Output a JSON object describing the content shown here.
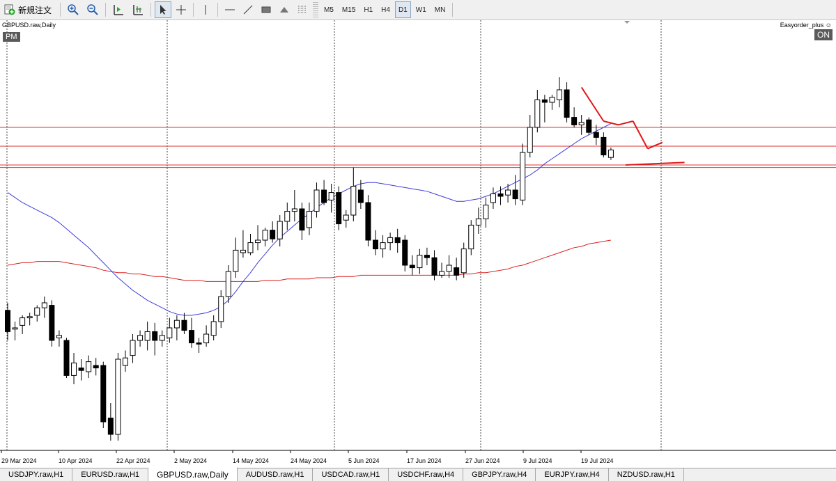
{
  "toolbar": {
    "new_order_label": "新規注文",
    "timeframes": [
      "M5",
      "M15",
      "H1",
      "H4",
      "D1",
      "W1",
      "MN"
    ],
    "active_timeframe": "D1"
  },
  "chart": {
    "title": "GBPUSD.raw,Daily",
    "session_badge": "PM",
    "ea_name": "Easyorder_plus ☺",
    "ea_status": "ON",
    "date_labels": [
      "29 Mar 2024",
      "10 Apr 2024",
      "22 Apr 2024",
      "2 May 2024",
      "14 May 2024",
      "24 May 2024",
      "5 Jun 2024",
      "17 Jun 2024",
      "27 Jun 2024",
      "9 Jul 2024",
      "19 Jul 2024"
    ]
  },
  "colors": {
    "ma_fast": "#3c3cdc",
    "ma_slow": "#dc2020",
    "hline": "#e03030",
    "annotation": "#e01818",
    "candle_bear": "#000000",
    "candle_bull": "#ffffff"
  },
  "chart_data": {
    "type": "candlestick",
    "symbol": "GBPUSD.raw",
    "period": "Daily",
    "candles": [
      {
        "o": 64,
        "h": 70,
        "l": 40,
        "c": 47
      },
      {
        "o": 49,
        "h": 55,
        "l": 40,
        "c": 50
      },
      {
        "o": 52,
        "h": 60,
        "l": 45,
        "c": 58
      },
      {
        "o": 58,
        "h": 62,
        "l": 52,
        "c": 59
      },
      {
        "o": 60,
        "h": 68,
        "l": 55,
        "c": 66
      },
      {
        "o": 66,
        "h": 75,
        "l": 58,
        "c": 70
      },
      {
        "o": 68,
        "h": 72,
        "l": 35,
        "c": 40
      },
      {
        "o": 42,
        "h": 48,
        "l": 35,
        "c": 44
      },
      {
        "o": 40,
        "h": 42,
        "l": 10,
        "c": 12
      },
      {
        "o": 12,
        "h": 30,
        "l": 5,
        "c": 22
      },
      {
        "o": 18,
        "h": 25,
        "l": 8,
        "c": 16
      },
      {
        "o": 15,
        "h": 28,
        "l": 10,
        "c": 23
      },
      {
        "o": 20,
        "h": 26,
        "l": 12,
        "c": 18
      },
      {
        "o": 20,
        "h": 23,
        "l": -30,
        "c": -25
      },
      {
        "o": -22,
        "h": -10,
        "l": -40,
        "c": -35
      },
      {
        "o": -35,
        "h": 30,
        "l": -40,
        "c": 25
      },
      {
        "o": 20,
        "h": 32,
        "l": 15,
        "c": 26
      },
      {
        "o": 28,
        "h": 45,
        "l": 22,
        "c": 40
      },
      {
        "o": 40,
        "h": 48,
        "l": 35,
        "c": 44
      },
      {
        "o": 40,
        "h": 55,
        "l": 32,
        "c": 47
      },
      {
        "o": 47,
        "h": 54,
        "l": 28,
        "c": 40
      },
      {
        "o": 40,
        "h": 48,
        "l": 35,
        "c": 44
      },
      {
        "o": 42,
        "h": 58,
        "l": 38,
        "c": 50
      },
      {
        "o": 50,
        "h": 60,
        "l": 40,
        "c": 56
      },
      {
        "o": 56,
        "h": 62,
        "l": 45,
        "c": 48
      },
      {
        "o": 48,
        "h": 58,
        "l": 34,
        "c": 38
      },
      {
        "o": 38,
        "h": 42,
        "l": 30,
        "c": 37
      },
      {
        "o": 38,
        "h": 52,
        "l": 35,
        "c": 45
      },
      {
        "o": 44,
        "h": 60,
        "l": 40,
        "c": 55
      },
      {
        "o": 55,
        "h": 80,
        "l": 50,
        "c": 75
      },
      {
        "o": 75,
        "h": 100,
        "l": 70,
        "c": 95
      },
      {
        "o": 95,
        "h": 122,
        "l": 90,
        "c": 112
      },
      {
        "o": 110,
        "h": 128,
        "l": 106,
        "c": 112
      },
      {
        "o": 110,
        "h": 125,
        "l": 108,
        "c": 118
      },
      {
        "o": 118,
        "h": 132,
        "l": 112,
        "c": 120
      },
      {
        "o": 120,
        "h": 130,
        "l": 115,
        "c": 128
      },
      {
        "o": 128,
        "h": 135,
        "l": 118,
        "c": 121
      },
      {
        "o": 121,
        "h": 140,
        "l": 115,
        "c": 135
      },
      {
        "o": 135,
        "h": 150,
        "l": 128,
        "c": 143
      },
      {
        "o": 143,
        "h": 160,
        "l": 135,
        "c": 145
      },
      {
        "o": 145,
        "h": 150,
        "l": 120,
        "c": 128
      },
      {
        "o": 130,
        "h": 150,
        "l": 124,
        "c": 143
      },
      {
        "o": 143,
        "h": 166,
        "l": 138,
        "c": 160
      },
      {
        "o": 160,
        "h": 168,
        "l": 148,
        "c": 150
      },
      {
        "o": 152,
        "h": 165,
        "l": 142,
        "c": 158
      },
      {
        "o": 158,
        "h": 163,
        "l": 128,
        "c": 133
      },
      {
        "o": 136,
        "h": 144,
        "l": 130,
        "c": 140
      },
      {
        "o": 140,
        "h": 178,
        "l": 135,
        "c": 163
      },
      {
        "o": 160,
        "h": 168,
        "l": 145,
        "c": 150
      },
      {
        "o": 150,
        "h": 156,
        "l": 115,
        "c": 120
      },
      {
        "o": 120,
        "h": 128,
        "l": 108,
        "c": 113
      },
      {
        "o": 113,
        "h": 124,
        "l": 106,
        "c": 118
      },
      {
        "o": 118,
        "h": 126,
        "l": 112,
        "c": 122
      },
      {
        "o": 122,
        "h": 129,
        "l": 110,
        "c": 118
      },
      {
        "o": 120,
        "h": 124,
        "l": 95,
        "c": 100
      },
      {
        "o": 100,
        "h": 108,
        "l": 92,
        "c": 98
      },
      {
        "o": 98,
        "h": 113,
        "l": 93,
        "c": 108
      },
      {
        "o": 108,
        "h": 114,
        "l": 100,
        "c": 106
      },
      {
        "o": 106,
        "h": 112,
        "l": 88,
        "c": 92
      },
      {
        "o": 92,
        "h": 102,
        "l": 90,
        "c": 95
      },
      {
        "o": 95,
        "h": 108,
        "l": 90,
        "c": 100
      },
      {
        "o": 98,
        "h": 106,
        "l": 88,
        "c": 92
      },
      {
        "o": 94,
        "h": 118,
        "l": 90,
        "c": 113
      },
      {
        "o": 113,
        "h": 136,
        "l": 108,
        "c": 132
      },
      {
        "o": 132,
        "h": 146,
        "l": 125,
        "c": 137
      },
      {
        "o": 137,
        "h": 154,
        "l": 130,
        "c": 148
      },
      {
        "o": 150,
        "h": 162,
        "l": 145,
        "c": 157
      },
      {
        "o": 157,
        "h": 163,
        "l": 148,
        "c": 155
      },
      {
        "o": 156,
        "h": 165,
        "l": 150,
        "c": 160
      },
      {
        "o": 160,
        "h": 172,
        "l": 148,
        "c": 153
      },
      {
        "o": 152,
        "h": 197,
        "l": 148,
        "c": 190
      },
      {
        "o": 190,
        "h": 220,
        "l": 186,
        "c": 210
      },
      {
        "o": 210,
        "h": 240,
        "l": 206,
        "c": 232
      },
      {
        "o": 232,
        "h": 236,
        "l": 214,
        "c": 230
      },
      {
        "o": 230,
        "h": 236,
        "l": 224,
        "c": 234
      },
      {
        "o": 232,
        "h": 250,
        "l": 226,
        "c": 240
      },
      {
        "o": 240,
        "h": 246,
        "l": 214,
        "c": 218
      },
      {
        "o": 218,
        "h": 226,
        "l": 210,
        "c": 212
      },
      {
        "o": 212,
        "h": 220,
        "l": 204,
        "c": 214
      },
      {
        "o": 216,
        "h": 218,
        "l": 204,
        "c": 206
      },
      {
        "o": 206,
        "h": 212,
        "l": 196,
        "c": 202
      },
      {
        "o": 202,
        "h": 206,
        "l": 186,
        "c": 188
      },
      {
        "o": 186,
        "h": 194,
        "l": 184,
        "c": 192
      }
    ],
    "ma_fast": [
      158,
      154,
      150,
      147,
      144,
      141,
      138,
      134,
      129,
      124,
      119,
      114,
      108,
      102,
      96,
      90,
      85,
      80,
      76,
      72,
      69,
      66,
      63,
      61,
      60,
      60,
      61,
      62,
      64,
      67,
      72,
      79,
      87,
      94,
      102,
      109,
      116,
      122,
      127,
      132,
      137,
      141,
      146,
      150,
      154,
      157,
      160,
      163,
      165,
      166,
      166,
      165,
      164,
      163,
      162,
      161,
      160,
      159,
      157,
      155,
      153,
      151,
      151,
      152,
      153,
      155,
      157,
      160,
      163,
      166,
      169,
      172,
      176,
      181,
      185,
      189,
      193,
      197,
      201,
      204,
      207,
      210,
      213
    ],
    "ma_slow": [
      100,
      101,
      102,
      102,
      103,
      103,
      103,
      103,
      102,
      101,
      100,
      99,
      98,
      96,
      95,
      94,
      94,
      93,
      93,
      92,
      91,
      91,
      90,
      89,
      88,
      88,
      88,
      87,
      87,
      87,
      87,
      87,
      87,
      87,
      87,
      88,
      88,
      88,
      89,
      89,
      89,
      89,
      90,
      90,
      90,
      91,
      91,
      91,
      92,
      92,
      92,
      92,
      92,
      92,
      92,
      92,
      92,
      92,
      92,
      92,
      92,
      92,
      93,
      93,
      94,
      94,
      95,
      96,
      97,
      99,
      100,
      102,
      104,
      106,
      108,
      110,
      112,
      114,
      115,
      117,
      118,
      119,
      120
    ],
    "horizontal_lines": [
      210,
      195,
      180,
      178
    ],
    "annotation_lines": [
      {
        "from": [
          78,
          242
        ],
        "to": [
          81,
          215
        ]
      },
      {
        "from": [
          81,
          215
        ],
        "to": [
          83,
          212
        ]
      },
      {
        "from": [
          83,
          212
        ],
        "to": [
          85,
          215
        ]
      },
      {
        "from": [
          85,
          215
        ],
        "to": [
          87,
          193
        ]
      },
      {
        "from": [
          87,
          193
        ],
        "to": [
          89,
          198
        ]
      },
      {
        "from": [
          84,
          180
        ],
        "to": [
          92,
          182
        ]
      }
    ],
    "xlabels": [
      "29 Mar 2024",
      "10 Apr 2024",
      "22 Apr 2024",
      "2 May 2024",
      "14 May 2024",
      "24 May 2024",
      "5 Jun 2024",
      "17 Jun 2024",
      "27 Jun 2024",
      "9 Jul 2024",
      "19 Jul 2024"
    ]
  },
  "tabs": [
    {
      "label": "USDJPY.raw,H1",
      "active": false
    },
    {
      "label": "EURUSD.raw,H1",
      "active": false
    },
    {
      "label": "GBPUSD.raw,Daily",
      "active": true
    },
    {
      "label": "AUDUSD.raw,H1",
      "active": false
    },
    {
      "label": "USDCAD.raw,H1",
      "active": false
    },
    {
      "label": "USDCHF.raw,H4",
      "active": false
    },
    {
      "label": "GBPJPY.raw,H4",
      "active": false
    },
    {
      "label": "EURJPY.raw,H4",
      "active": false
    },
    {
      "label": "NZDUSD.raw,H1",
      "active": false
    }
  ]
}
